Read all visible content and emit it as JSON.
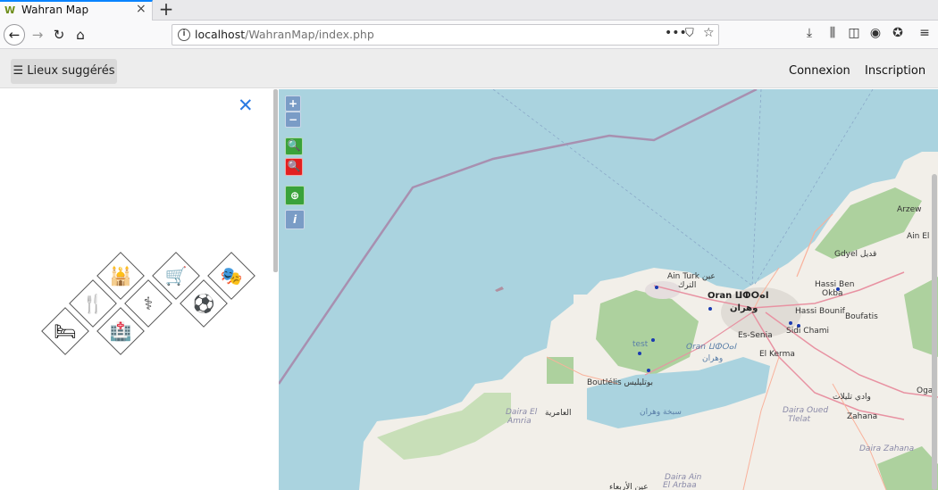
{
  "browser": {
    "tab_title": "Wahran Map",
    "tab_close": "×",
    "new_tab": "+",
    "url_host": "localhost",
    "url_path": "/WahranMap/index.php",
    "page_actions": "•••"
  },
  "appbar": {
    "suggest_button": "☰ Lieux suggérés",
    "login": "Connexion",
    "signup": "Inscription"
  },
  "sidebar": {
    "close": "✕",
    "categories": [
      "mosque",
      "shopping",
      "theatre",
      "restaurant",
      "pharmacy",
      "football",
      "hotel",
      "hospital"
    ]
  },
  "map": {
    "controls": [
      "+",
      "−"
    ],
    "labels": [
      {
        "text": "Arzew"
      },
      {
        "text": "Ain El B"
      },
      {
        "text": "Gdyel قديل"
      },
      {
        "text": "Hassi Ben"
      },
      {
        "text": "Okba"
      },
      {
        "text": "Ain Turk عين"
      },
      {
        "text": "الترك"
      },
      {
        "text": "Oran ⵡⵀⵔⴰⵏ"
      },
      {
        "text": "وهران"
      },
      {
        "text": "Hassi Bounif"
      },
      {
        "text": "Boufatis"
      },
      {
        "text": "Es-Senia"
      },
      {
        "text": "Sidi Chami"
      },
      {
        "text": "test"
      },
      {
        "text": "Oran ⵡⵀⵔⴰⵏ"
      },
      {
        "text": "وهران"
      },
      {
        "text": "El Kerma"
      },
      {
        "text": "Boutlélis بوتليليس"
      },
      {
        "text": "سبخة وهران"
      },
      {
        "text": "Daira El"
      },
      {
        "text": "Amria"
      },
      {
        "text": "العامرية"
      },
      {
        "text": "Daira Oued"
      },
      {
        "text": "Tlelat"
      },
      {
        "text": "وادي تليلات"
      },
      {
        "text": "Zahana"
      },
      {
        "text": "Daira Zahana"
      },
      {
        "text": "Daira Ain"
      },
      {
        "text": "El Arbaa"
      },
      {
        "text": "عين الأربعاء"
      },
      {
        "text": "Oga"
      }
    ]
  },
  "colors": {
    "sea": "#aad3df",
    "land": "#f2efe9",
    "green": "#add19e",
    "accent": "#2a7ae2"
  }
}
